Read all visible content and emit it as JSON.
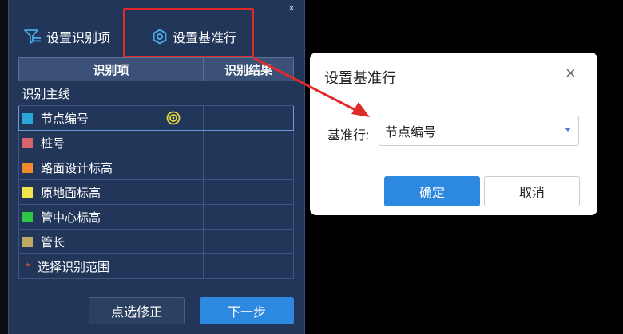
{
  "toolbar": {
    "set_items_label": "设置识别项",
    "set_base_row_label": "设置基准行",
    "close": "×"
  },
  "table": {
    "headers": [
      "识别项",
      "识别结果"
    ],
    "group_label": "识别主线",
    "rows": [
      {
        "label": "节点编号",
        "color": "#29a7d9",
        "selected": true
      },
      {
        "label": "桩号",
        "color": "#d9636a"
      },
      {
        "label": "路面设计标高",
        "color": "#f08a2a"
      },
      {
        "label": "原地面标高",
        "color": "#f0e54a"
      },
      {
        "label": "管中心标高",
        "color": "#2ec743"
      },
      {
        "label": "管长",
        "color": "#bda865"
      }
    ],
    "range_label": "选择识别范围",
    "range_marker": "*"
  },
  "buttons": {
    "fix": "点选修正",
    "next": "下一步"
  },
  "dialog": {
    "title": "设置基准行",
    "close": "×",
    "field_label": "基准行:",
    "field_value": "节点编号",
    "ok": "确定",
    "cancel": "取消"
  },
  "colors": {
    "panel": "#22365a",
    "accent": "#2d88e0",
    "highlight": "#e02a2a"
  }
}
